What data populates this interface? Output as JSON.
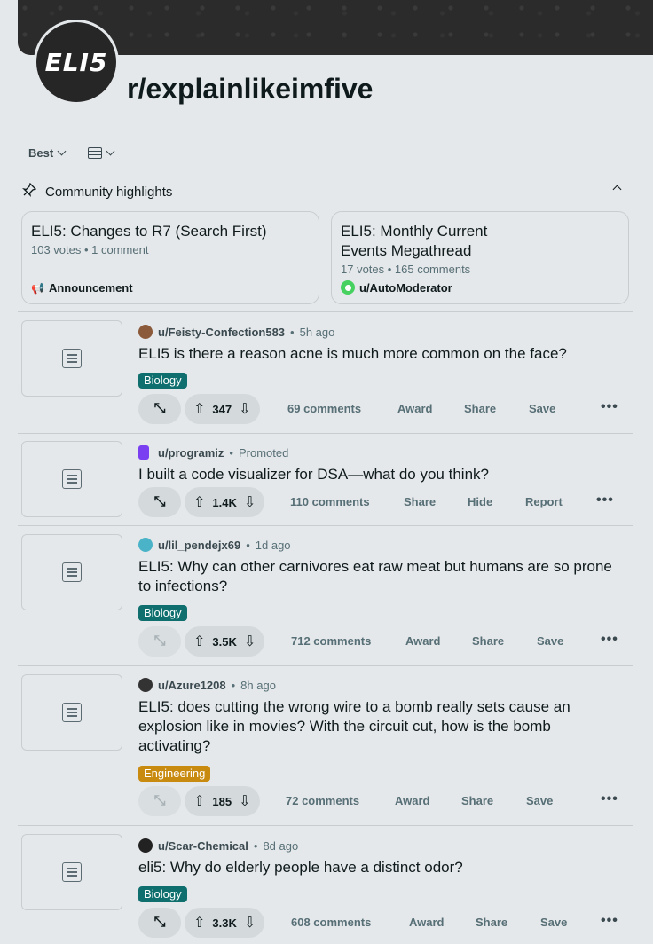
{
  "header": {
    "avatar_text": "ELI5",
    "subreddit": "r/explainlikeimfive"
  },
  "sortbar": {
    "sort_label": "Best",
    "layout_icon": "card-view-icon"
  },
  "highlights": {
    "label": "Community highlights",
    "cards": [
      {
        "title": "ELI5: Changes to R7 (Search First)",
        "meta": "103 votes • 1 comment",
        "footer": "Announcement",
        "footer_icon": "megaphone-icon"
      },
      {
        "title": "ELI5: Monthly Current Events Megathread",
        "meta": "17 votes • 165 comments",
        "footer": "u/AutoModerator",
        "footer_icon": "mod-shield-icon"
      }
    ]
  },
  "posts": [
    {
      "user": "u/Feisty-Confection583",
      "time": "5h ago",
      "title": "ELI5 is there a reason acne is much more common on the face?",
      "flair": "Biology",
      "votes": "347",
      "comments": "69 comments",
      "a1": "Award",
      "a2": "Share",
      "a3": "Save",
      "avatar_color": "#8a5a3a"
    },
    {
      "user": "u/programiz",
      "time": "Promoted",
      "title": "I built a code visualizer for DSA—what do you think?",
      "votes": "1.4K",
      "comments": "110 comments",
      "a1": "Share",
      "a2": "Hide",
      "a3": "Report",
      "avatar_color": "#7b3ff2"
    },
    {
      "user": "u/lil_pendejx69",
      "time": "1d ago",
      "title": "ELI5: Why can other carnivores eat raw meat but humans are so prone to infections?",
      "flair": "Biology",
      "votes": "3.5K",
      "comments": "712 comments",
      "a1": "Award",
      "a2": "Share",
      "a3": "Save",
      "avatar_color": "#4ab3c8"
    },
    {
      "user": "u/Azure1208",
      "time": "8h ago",
      "title": "ELI5: does cutting the wrong wire to a bomb really sets cause an explosion like in movies? With the circuit cut, how is the bomb activating?",
      "flair": "Engineering",
      "votes": "185",
      "comments": "72 comments",
      "a1": "Award",
      "a2": "Share",
      "a3": "Save",
      "avatar_color": "#333333"
    },
    {
      "user": "u/Scar-Chemical",
      "time": "8d ago",
      "title": "eli5: Why do elderly people have a distinct odor?",
      "flair": "Biology",
      "votes": "3.3K",
      "comments": "608 comments",
      "a1": "Award",
      "a2": "Share",
      "a3": "Save",
      "avatar_color": "#222222"
    }
  ],
  "more_label": "•••"
}
